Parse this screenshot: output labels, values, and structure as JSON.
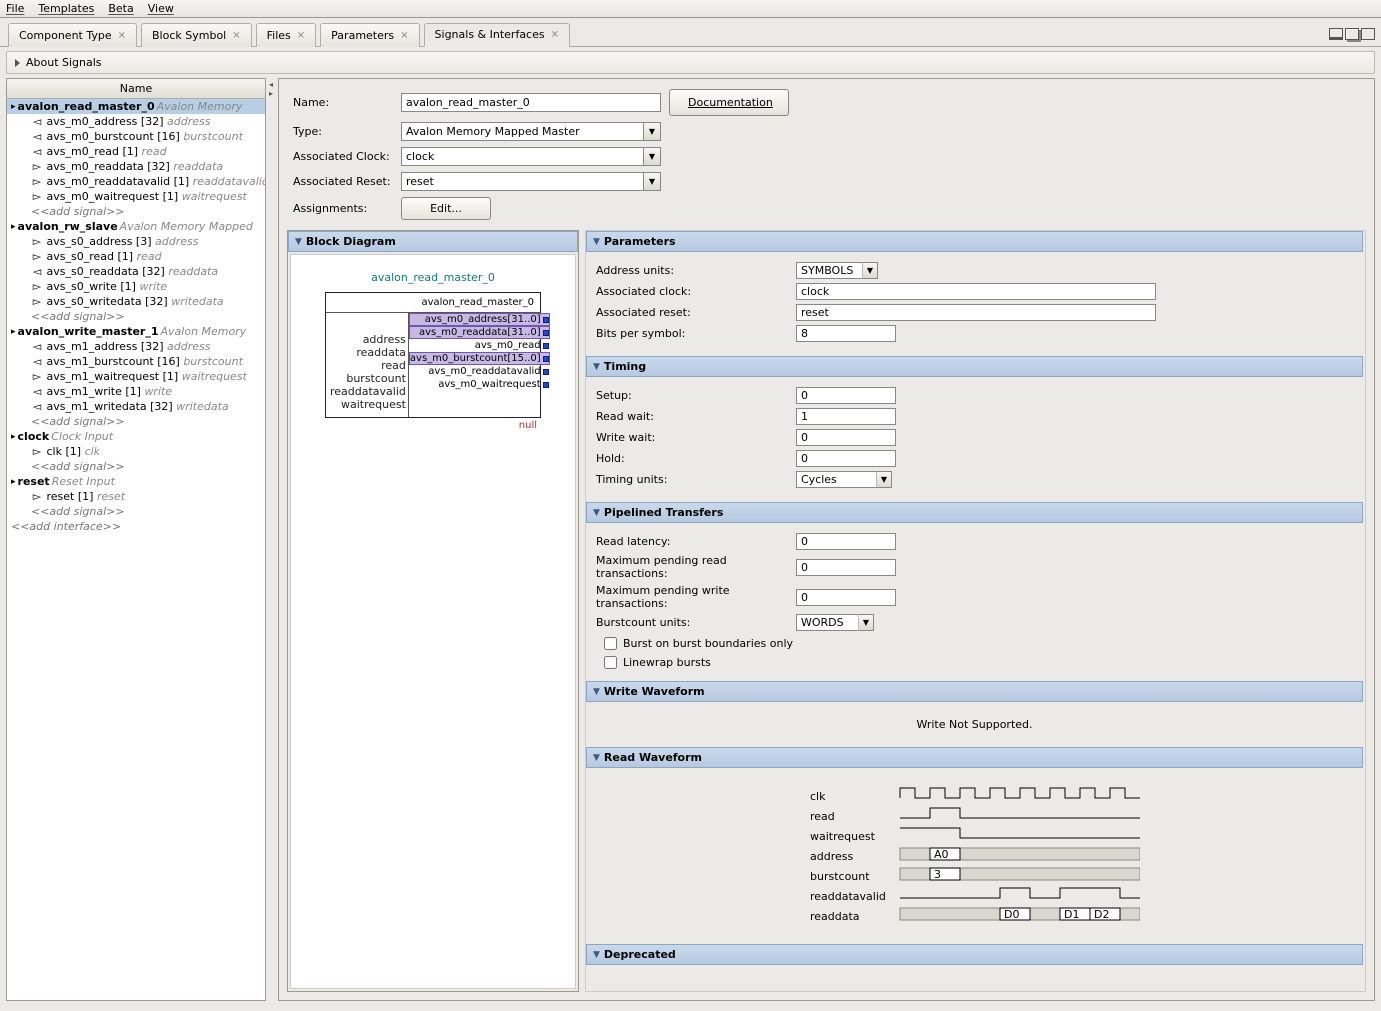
{
  "menu": {
    "file": "File",
    "templates": "Templates",
    "beta": "Beta",
    "view": "View"
  },
  "tabs": [
    {
      "label": "Component Type"
    },
    {
      "label": "Block Symbol"
    },
    {
      "label": "Files"
    },
    {
      "label": "Parameters"
    },
    {
      "label": "Signals & Interfaces",
      "active": true
    }
  ],
  "about": "About Signals",
  "tree": {
    "header": "Name",
    "add_interface": "<<add interface>>",
    "interfaces": [
      {
        "name": "avalon_read_master_0",
        "type": "Avalon Memory",
        "selected": true,
        "signals": [
          {
            "dir": "out",
            "name": "avs_m0_address [32]",
            "hint": "address"
          },
          {
            "dir": "out",
            "name": "avs_m0_burstcount [16]",
            "hint": "burstcount"
          },
          {
            "dir": "out",
            "name": "avs_m0_read [1]",
            "hint": "read"
          },
          {
            "dir": "in",
            "name": "avs_m0_readdata [32]",
            "hint": "readdata"
          },
          {
            "dir": "in",
            "name": "avs_m0_readdatavalid [1]",
            "hint": "readdatavalid"
          },
          {
            "dir": "in",
            "name": "avs_m0_waitrequest [1]",
            "hint": "waitrequest"
          }
        ],
        "add": "<<add signal>>"
      },
      {
        "name": "avalon_rw_slave",
        "type": "Avalon Memory Mapped",
        "signals": [
          {
            "dir": "in",
            "name": "avs_s0_address [3]",
            "hint": "address"
          },
          {
            "dir": "in",
            "name": "avs_s0_read [1]",
            "hint": "read"
          },
          {
            "dir": "out",
            "name": "avs_s0_readdata [32]",
            "hint": "readdata"
          },
          {
            "dir": "in",
            "name": "avs_s0_write [1]",
            "hint": "write"
          },
          {
            "dir": "in",
            "name": "avs_s0_writedata [32]",
            "hint": "writedata"
          }
        ],
        "add": "<<add signal>>"
      },
      {
        "name": "avalon_write_master_1",
        "type": "Avalon Memory",
        "signals": [
          {
            "dir": "out",
            "name": "avs_m1_address [32]",
            "hint": "address"
          },
          {
            "dir": "out",
            "name": "avs_m1_burstcount [16]",
            "hint": "burstcount"
          },
          {
            "dir": "in",
            "name": "avs_m1_waitrequest [1]",
            "hint": "waitrequest"
          },
          {
            "dir": "out",
            "name": "avs_m1_write [1]",
            "hint": "write"
          },
          {
            "dir": "out",
            "name": "avs_m1_writedata [32]",
            "hint": "writedata"
          }
        ],
        "add": "<<add signal>>"
      },
      {
        "name": "clock",
        "type": "Clock Input",
        "signals": [
          {
            "dir": "in",
            "name": "clk [1]",
            "hint": "clk"
          }
        ],
        "add": "<<add signal>>"
      },
      {
        "name": "reset",
        "type": "Reset Input",
        "signals": [
          {
            "dir": "in",
            "name": "reset [1]",
            "hint": "reset"
          }
        ],
        "add": "<<add signal>>"
      }
    ]
  },
  "form": {
    "name_lbl": "Name:",
    "name_val": "avalon_read_master_0",
    "doc_btn": "Documentation",
    "type_lbl": "Type:",
    "type_val": "Avalon Memory Mapped Master",
    "clock_lbl": "Associated Clock:",
    "clock_val": "clock",
    "reset_lbl": "Associated Reset:",
    "reset_val": "reset",
    "assign_lbl": "Assignments:",
    "edit_btn": "Edit..."
  },
  "bd": {
    "title": "Block Diagram",
    "block_name": "avalon_read_master_0",
    "iface_label": "avalon_read_master_0",
    "labels": [
      "address",
      "readdata",
      "read",
      "burstcount",
      "readdatavalid",
      "waitrequest"
    ],
    "sigs": [
      "avs_m0_address[31..0]",
      "avs_m0_readdata[31..0]",
      "avs_m0_read",
      "avs_m0_burstcount[15..0]",
      "avs_m0_readdatavalid",
      "avs_m0_waitrequest"
    ],
    "null": "null"
  },
  "sections": {
    "parameters": {
      "title": "Parameters",
      "addr_units_lbl": "Address units:",
      "addr_units_val": "SYMBOLS",
      "assoc_clock_lbl": "Associated clock:",
      "assoc_clock_val": "clock",
      "assoc_reset_lbl": "Associated reset:",
      "assoc_reset_val": "reset",
      "bps_lbl": "Bits per symbol:",
      "bps_val": "8"
    },
    "timing": {
      "title": "Timing",
      "setup_lbl": "Setup:",
      "setup_val": "0",
      "read_wait_lbl": "Read wait:",
      "read_wait_val": "1",
      "write_wait_lbl": "Write wait:",
      "write_wait_val": "0",
      "hold_lbl": "Hold:",
      "hold_val": "0",
      "units_lbl": "Timing units:",
      "units_val": "Cycles"
    },
    "pipelined": {
      "title": "Pipelined Transfers",
      "latency_lbl": "Read latency:",
      "latency_val": "0",
      "max_read_lbl": "Maximum pending read transactions:",
      "max_read_val": "0",
      "max_write_lbl": "Maximum pending write transactions:",
      "max_write_val": "0",
      "burst_units_lbl": "Burstcount units:",
      "burst_units_val": "WORDS",
      "chk1": "Burst on burst boundaries only",
      "chk2": "Linewrap bursts"
    },
    "write_wave": {
      "title": "Write Waveform",
      "msg": "Write Not Supported."
    },
    "read_wave": {
      "title": "Read Waveform",
      "labels": [
        "clk",
        "read",
        "waitrequest",
        "address",
        "burstcount",
        "readdatavalid",
        "readdata"
      ],
      "addr_tag": "A0",
      "burst_tag": "3",
      "data_tags": [
        "D0",
        "D1",
        "D2"
      ]
    },
    "deprecated": {
      "title": "Deprecated"
    }
  }
}
